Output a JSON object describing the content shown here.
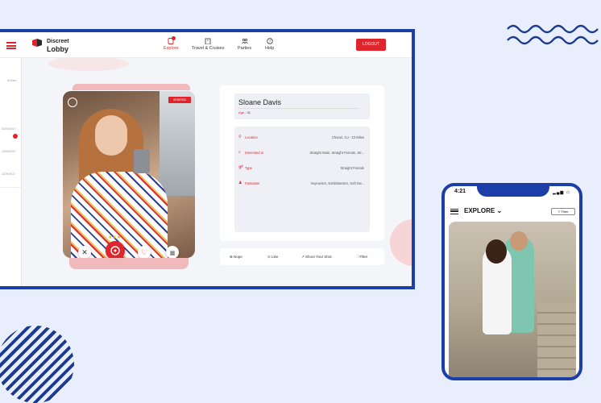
{
  "header": {
    "logo_top": "Discreet",
    "logo_bottom": "Lobby",
    "nav": [
      {
        "label": "Explore",
        "icon": "explore-icon",
        "active": true
      },
      {
        "label": "Travel & Cruises",
        "icon": "building-icon",
        "active": false
      },
      {
        "label": "Parties",
        "icon": "people-icon",
        "active": false
      },
      {
        "label": "Help",
        "icon": "help-icon",
        "active": false
      }
    ],
    "logout_label": "LOGOUT"
  },
  "sidebar": {
    "items": [
      "5:11am",
      "02/09/2017",
      "10/09/2017",
      "11/09/2017"
    ],
    "badge": "1"
  },
  "profile": {
    "badge": "VERIFIED",
    "name": "Sloane Davis",
    "age_label": "Age :",
    "age_value": "31",
    "details": [
      {
        "icon": "location-pin-icon",
        "key": "Location",
        "value": "Chunel, GJ - 23 Miles"
      },
      {
        "icon": "search-icon",
        "key": "Interested In",
        "value": "Straight Male, Straight Female, Str..."
      },
      {
        "icon": "type-icon",
        "key": "Type",
        "value": "Straight Female"
      },
      {
        "icon": "fantasy-icon",
        "key": "Fantasies",
        "value": "Voyeurism, Exhibitionism, Soft Sw..."
      }
    ]
  },
  "action_bar": {
    "nope": "Nope",
    "like": "Like",
    "shoot": "Shoot Your Shot",
    "filter": "Filter"
  },
  "mobile": {
    "time": "4:21",
    "title": "EXPLORE",
    "filter_label": "Filter"
  },
  "colors": {
    "accent": "#e0242c",
    "frame": "#1b3fa6",
    "background": "#e8eefb"
  }
}
